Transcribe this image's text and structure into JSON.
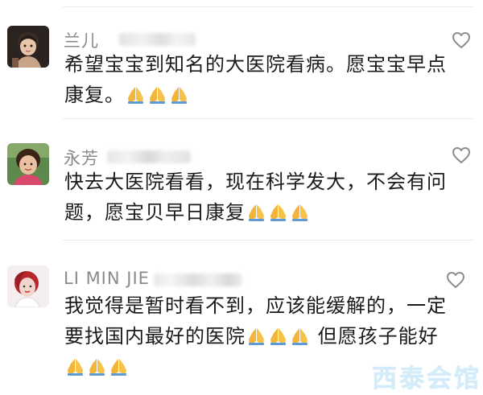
{
  "comments": [
    {
      "username": "兰儿",
      "text_before": "希望宝宝到知名的大医院看病。愿宝宝早点康复。",
      "text_after": "",
      "trailing_text": "",
      "avatar_icon": "child-avatar-icon",
      "emoji_icon": "folded-hands-icon"
    },
    {
      "username": "永芳",
      "text_before": "快去大医院看看，现在科学发大，不会有问题，愿宝贝早日康复",
      "text_after": "",
      "trailing_text": "",
      "avatar_icon": "woman-avatar-icon",
      "emoji_icon": "folded-hands-icon"
    },
    {
      "username": "LI MIN JIE",
      "text_before": "我觉得是暂时看不到，应该能缓解的，一定要找国内最好的医院",
      "text_after": "但愿孩子能好",
      "trailing_text": "",
      "avatar_icon": "woman-avatar-icon",
      "emoji_icon": "folded-hands-icon"
    }
  ],
  "watermark": "西泰会馆",
  "colors": {
    "username": "#8a8a8a",
    "text": "#1a1a1a",
    "divider": "#ececec",
    "heart_stroke": "#8c8c8c",
    "watermark": "#d4ecfa"
  }
}
